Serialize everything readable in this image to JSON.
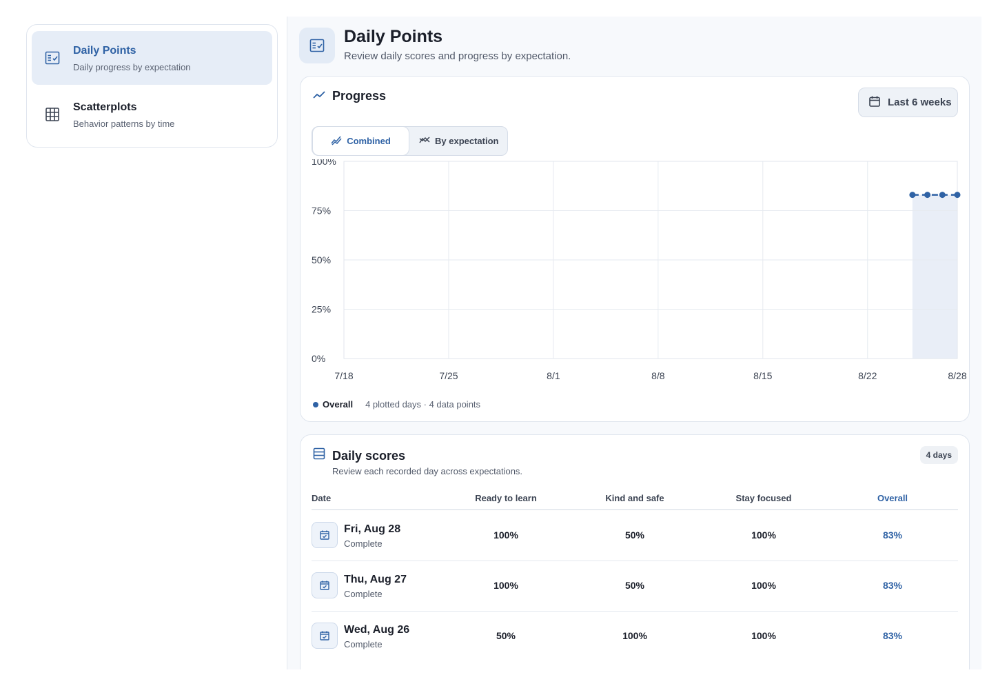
{
  "sidebar": {
    "items": [
      {
        "title": "Daily Points",
        "subtitle": "Daily progress by expectation",
        "active": true,
        "icon": "checklist-icon"
      },
      {
        "title": "Scatterplots",
        "subtitle": "Behavior patterns by time",
        "active": false,
        "icon": "grid-icon"
      }
    ]
  },
  "header": {
    "title": "Daily Points",
    "subtitle": "Review daily scores and progress by expectation."
  },
  "progress": {
    "title": "Progress",
    "range_label": "Last 6 weeks",
    "tabs": {
      "combined": "Combined",
      "by_expectation": "By expectation"
    },
    "legend": {
      "series": "Overall",
      "meta": "4 plotted days · 4 data points"
    }
  },
  "chart_data": {
    "type": "line",
    "y_tick_labels": [
      "100%",
      "75%",
      "50%",
      "25%",
      "0%"
    ],
    "x_tick_labels": [
      "7/18",
      "7/25",
      "8/1",
      "8/8",
      "8/15",
      "8/22",
      "8/28"
    ],
    "ylim": [
      0,
      100
    ],
    "xlim": [
      "2026-07-18",
      "2026-08-28"
    ],
    "grid": true,
    "highlight_range": [
      "2026-08-25",
      "2026-08-28"
    ],
    "series": [
      {
        "name": "Overall",
        "x": [
          "2026-08-25",
          "2026-08-26",
          "2026-08-27",
          "2026-08-28"
        ],
        "values": [
          83,
          83,
          83,
          83
        ],
        "color": "#2f62a5"
      }
    ],
    "legend_position": "bottom-left"
  },
  "scores": {
    "title": "Daily scores",
    "subtitle": "Review each recorded day across expectations.",
    "badge": "4 days",
    "columns": [
      "Date",
      "Ready to learn",
      "Kind and safe",
      "Stay focused",
      "Overall"
    ],
    "rows": [
      {
        "date": "Fri, Aug 28",
        "status": "Complete",
        "ready": "100%",
        "kind": "50%",
        "focused": "100%",
        "overall": "83%"
      },
      {
        "date": "Thu, Aug 27",
        "status": "Complete",
        "ready": "100%",
        "kind": "50%",
        "focused": "100%",
        "overall": "83%"
      },
      {
        "date": "Wed, Aug 26",
        "status": "Complete",
        "ready": "50%",
        "kind": "100%",
        "focused": "100%",
        "overall": "83%"
      }
    ]
  },
  "colors": {
    "accent": "#2f62a5",
    "active_bg": "#e6edf7",
    "highlight": "#e9eef7"
  }
}
